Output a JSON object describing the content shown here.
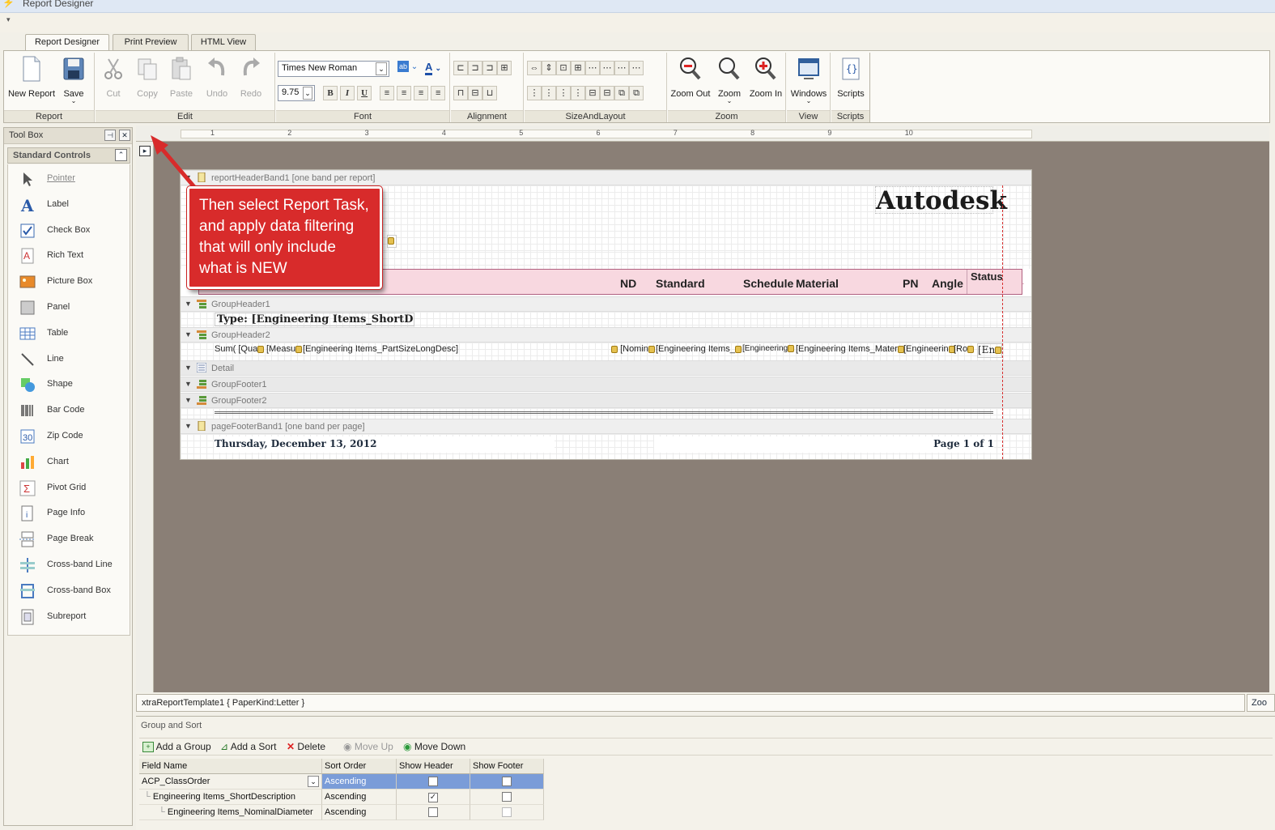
{
  "window": {
    "title": "Report Designer"
  },
  "tabs": [
    {
      "label": "Report Designer",
      "active": true
    },
    {
      "label": "Print Preview",
      "active": false
    },
    {
      "label": "HTML View",
      "active": false
    }
  ],
  "ribbon": {
    "report": {
      "label": "Report",
      "new_report": "New Report",
      "save": "Save"
    },
    "edit": {
      "label": "Edit",
      "cut": "Cut",
      "copy": "Copy",
      "paste": "Paste",
      "undo": "Undo",
      "redo": "Redo"
    },
    "font": {
      "label": "Font",
      "family": "Times New Roman",
      "size": "9.75",
      "bold": "B",
      "italic": "I",
      "underline": "U"
    },
    "alignment": {
      "label": "Alignment"
    },
    "size_layout": {
      "label": "SizeAndLayout"
    },
    "zoom": {
      "label": "Zoom",
      "zoom_out": "Zoom Out",
      "zoom": "Zoom",
      "zoom_in": "Zoom In"
    },
    "view": {
      "label": "View",
      "windows": "Windows"
    },
    "scripts": {
      "label": "Scripts",
      "scripts": "Scripts"
    }
  },
  "toolbox": {
    "title": "Tool Box",
    "section": "Standard Controls",
    "items": [
      {
        "label": "Pointer",
        "icon": "pointer-icon"
      },
      {
        "label": "Label",
        "icon": "label-icon"
      },
      {
        "label": "Check Box",
        "icon": "checkbox-icon"
      },
      {
        "label": "Rich Text",
        "icon": "rich-text-icon"
      },
      {
        "label": "Picture Box",
        "icon": "picture-icon"
      },
      {
        "label": "Panel",
        "icon": "panel-icon"
      },
      {
        "label": "Table",
        "icon": "table-icon"
      },
      {
        "label": "Line",
        "icon": "line-icon"
      },
      {
        "label": "Shape",
        "icon": "shape-icon"
      },
      {
        "label": "Bar Code",
        "icon": "barcode-icon"
      },
      {
        "label": "Zip Code",
        "icon": "zipcode-icon"
      },
      {
        "label": "Chart",
        "icon": "chart-icon"
      },
      {
        "label": "Pivot Grid",
        "icon": "pivot-icon"
      },
      {
        "label": "Page Info",
        "icon": "page-info-icon"
      },
      {
        "label": "Page Break",
        "icon": "page-break-icon"
      },
      {
        "label": "Cross-band Line",
        "icon": "cross-band-line-icon"
      },
      {
        "label": "Cross-band Box",
        "icon": "cross-band-box-icon"
      },
      {
        "label": "Subreport",
        "icon": "subreport-icon"
      }
    ]
  },
  "ruler": {
    "numbers": [
      "1",
      "2",
      "3",
      "4",
      "5",
      "6",
      "7",
      "8",
      "9",
      "10"
    ]
  },
  "report": {
    "bands": {
      "report_header": "reportHeaderBand1 [one band per report]",
      "group_header1": "GroupHeader1",
      "group_header2": "GroupHeader2",
      "detail": "Detail",
      "group_footer1": "GroupFooter1",
      "group_footer2": "GroupFooter2",
      "page_footer": "pageFooterBand1 [one band per page]"
    },
    "logo": "Autodesk",
    "columns": {
      "nd": "ND",
      "standard": "Standard",
      "schedule": "Schedule",
      "material": "Material",
      "pn": "PN",
      "angle": "Angle",
      "status": "Status"
    },
    "type_field": "Type: [Engineering Items_ShortDescri",
    "row": {
      "sum": "Sum( [Qua",
      "meas": "[Measu",
      "long_desc": "[Engineering Items_PartSizeLongDesc]",
      "nomin": "[Nomin",
      "eng1": "[Engineering Items_",
      "eng2": "[Engineering",
      "material": "[Engineering Items_Mater",
      "eng3": "[Engineerin",
      "ro": "[Ro",
      "en": "[En"
    },
    "footer_date": "Thursday, December 13, 2012",
    "footer_page": "Page 1 of 1"
  },
  "callout": "Then select Report Task, and apply data filtering that will only include what is NEW",
  "status_bar": {
    "text": "xtraReportTemplate1 { PaperKind:Letter }",
    "zoom": "Zoo"
  },
  "group_sort": {
    "title": "Group and Sort",
    "toolbar": {
      "add_group": "Add a Group",
      "add_sort": "Add a Sort",
      "delete": "Delete",
      "move_up": "Move Up",
      "move_down": "Move Down"
    },
    "headers": {
      "field": "Field Name",
      "sort": "Sort Order",
      "show_header": "Show Header",
      "show_footer": "Show Footer"
    },
    "rows": [
      {
        "field": "ACP_ClassOrder",
        "sort": "Ascending",
        "header": false,
        "footer": false
      },
      {
        "field": "Engineering Items_ShortDescription",
        "sort": "Ascending",
        "header": true,
        "footer": false
      },
      {
        "field": "Engineering Items_NominalDiameter",
        "sort": "Ascending",
        "header": false,
        "footer": false
      }
    ]
  }
}
